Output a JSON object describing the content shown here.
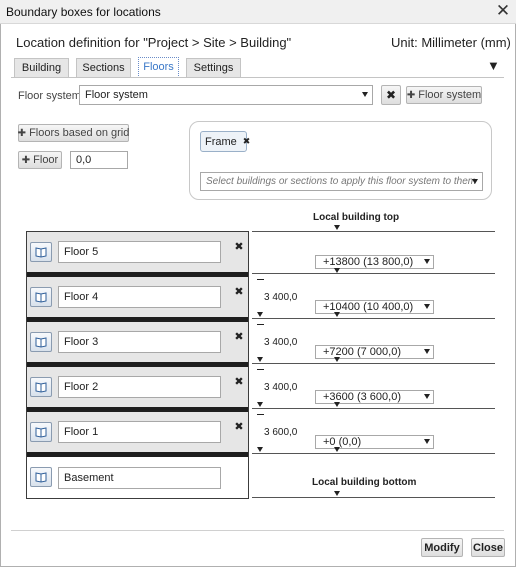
{
  "window": {
    "title": "Boundary boxes for locations",
    "close_glyph": "✕"
  },
  "header": {
    "location_text": "Location definition for \"Project > Site > Building\"",
    "unit_text": "Unit: Millimeter (mm)",
    "collapse_glyph": "▼"
  },
  "tabs": [
    {
      "label": "Building",
      "active": false
    },
    {
      "label": "Sections",
      "active": false
    },
    {
      "label": "Floors",
      "active": true
    },
    {
      "label": "Settings",
      "active": false
    }
  ],
  "floor_system": {
    "label": "Floor system",
    "selected": "Floor system",
    "clear_glyph": "✖",
    "add_button_label": "Floor system"
  },
  "grid_button": {
    "label": "Floors based on grid"
  },
  "add_floor": {
    "label": "Floor",
    "value": "0,0"
  },
  "tags_panel": {
    "tags": [
      {
        "label": "Frame",
        "remove_glyph": "✖"
      }
    ],
    "apply_placeholder": "Select buildings or sections to apply this floor system to them"
  },
  "plus_glyph": "✚",
  "levels": {
    "top_label": "Local building top",
    "bottom_label": "Local building bottom"
  },
  "floors": [
    {
      "name": "Floor 5",
      "delete_glyph": "✖",
      "level": "+13800 (13 800,0)",
      "height": ""
    },
    {
      "name": "Floor 4",
      "delete_glyph": "✖",
      "level": "+10400 (10 400,0)",
      "height": "3 400,0"
    },
    {
      "name": "Floor 3",
      "delete_glyph": "✖",
      "level": "+7200 (7 000,0)",
      "height": "3 400,0"
    },
    {
      "name": "Floor 2",
      "delete_glyph": "✖",
      "level": "+3600 (3 600,0)",
      "height": "3 400,0"
    },
    {
      "name": "Floor 1",
      "delete_glyph": "✖",
      "level": "+0 (0,0)",
      "height": "3 600,0"
    },
    {
      "name": "Basement",
      "delete_glyph": "",
      "level": "",
      "height": ""
    }
  ],
  "footer": {
    "modify_label": "Modify",
    "close_label": "Close"
  },
  "icons": {
    "floor_row": "book-icon",
    "accent": "#3a78c8"
  }
}
